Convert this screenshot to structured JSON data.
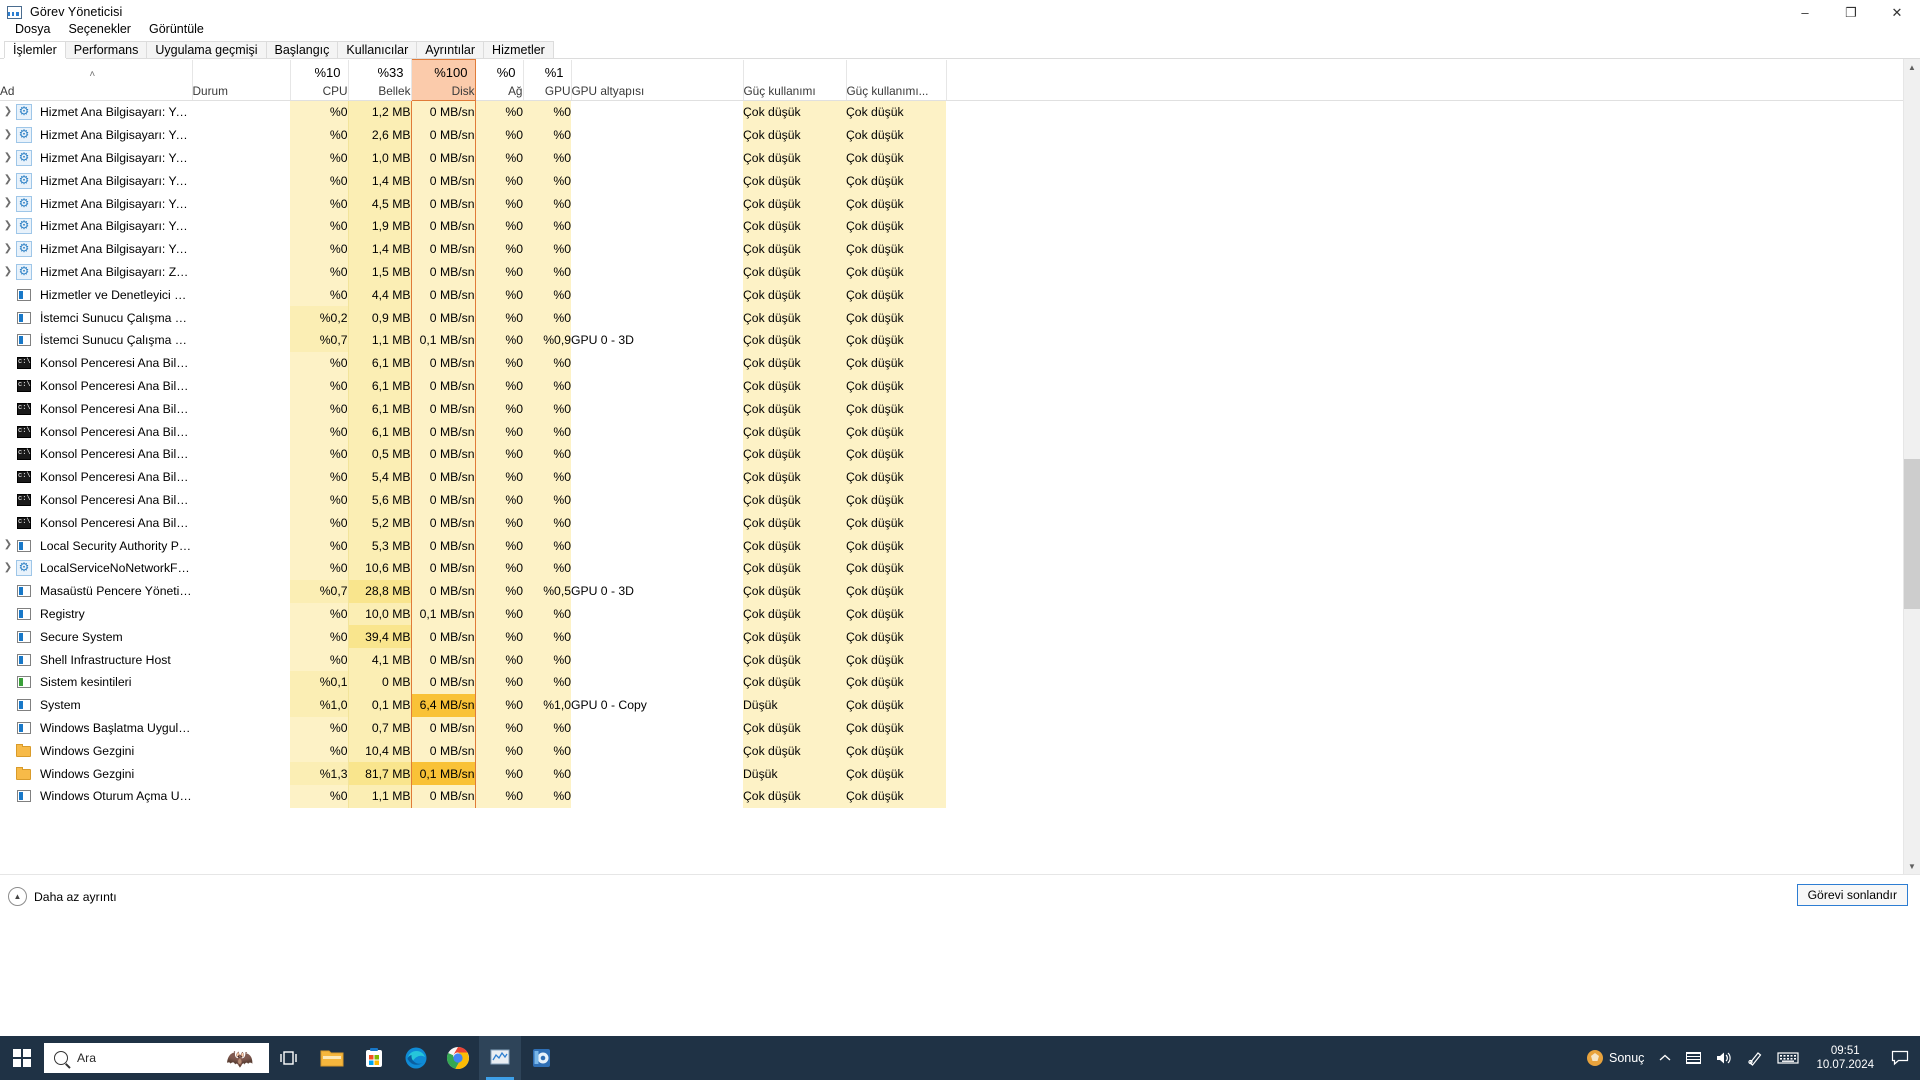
{
  "window": {
    "title": "Görev Yöneticisi",
    "icon": "task-manager-icon",
    "minimize": "–",
    "maximize": "❐",
    "close": "✕"
  },
  "menu": [
    "Dosya",
    "Seçenekler",
    "Görüntüle"
  ],
  "tabs": [
    {
      "label": "İşlemler",
      "active": true
    },
    {
      "label": "Performans",
      "active": false
    },
    {
      "label": "Uygulama geçmişi",
      "active": false
    },
    {
      "label": "Başlangıç",
      "active": false
    },
    {
      "label": "Kullanıcılar",
      "active": false
    },
    {
      "label": "Ayrıntılar",
      "active": false
    },
    {
      "label": "Hizmetler",
      "active": false
    }
  ],
  "table": {
    "sort_arrow": "˄",
    "headers": [
      {
        "key": "name",
        "label": "Ad",
        "pct": "",
        "align": "left",
        "hot": false
      },
      {
        "key": "status",
        "label": "Durum",
        "pct": "",
        "align": "left",
        "hot": false
      },
      {
        "key": "cpu",
        "label": "CPU",
        "pct": "%10",
        "align": "right",
        "hot": false
      },
      {
        "key": "mem",
        "label": "Bellek",
        "pct": "%33",
        "align": "right",
        "hot": false
      },
      {
        "key": "disk",
        "label": "Disk",
        "pct": "%100",
        "align": "right",
        "hot": true
      },
      {
        "key": "net",
        "label": "Ağ",
        "pct": "%0",
        "align": "right",
        "hot": false
      },
      {
        "key": "gpu",
        "label": "GPU",
        "pct": "%1",
        "align": "right",
        "hot": false
      },
      {
        "key": "gpueng",
        "label": "GPU altyapısı",
        "pct": "",
        "align": "left",
        "hot": false
      },
      {
        "key": "power",
        "label": "Güç kullanımı",
        "pct": "",
        "align": "left",
        "hot": false
      },
      {
        "key": "powtr",
        "label": "Güç kullanımı...",
        "pct": "",
        "align": "left",
        "hot": false
      }
    ],
    "rows": [
      {
        "icon": "gear-icon",
        "expand": true,
        "name": "Hizmet Ana Bilgisayarı: Yerel Hiz...",
        "status": "",
        "cpu": "%0",
        "mem": "1,2 MB",
        "disk": "0 MB/sn",
        "net": "%0",
        "gpu": "%0",
        "gpueng": "",
        "power": "Çok düşük",
        "powtr": "Çok düşük",
        "memLevel": 1,
        "diskLevel": 0,
        "cpuLevel": 0
      },
      {
        "icon": "gear-icon",
        "expand": true,
        "name": "Hizmet Ana Bilgisayarı: Yerel Hiz...",
        "status": "",
        "cpu": "%0",
        "mem": "2,6 MB",
        "disk": "0 MB/sn",
        "net": "%0",
        "gpu": "%0",
        "gpueng": "",
        "power": "Çok düşük",
        "powtr": "Çok düşük",
        "memLevel": 1,
        "diskLevel": 0,
        "cpuLevel": 0
      },
      {
        "icon": "gear-icon",
        "expand": true,
        "name": "Hizmet Ana Bilgisayarı: Yerel Hiz...",
        "status": "",
        "cpu": "%0",
        "mem": "1,0 MB",
        "disk": "0 MB/sn",
        "net": "%0",
        "gpu": "%0",
        "gpueng": "",
        "power": "Çok düşük",
        "powtr": "Çok düşük",
        "memLevel": 1,
        "diskLevel": 0,
        "cpuLevel": 0
      },
      {
        "icon": "gear-icon",
        "expand": true,
        "name": "Hizmet Ana Bilgisayarı: Yerel Ot...",
        "status": "",
        "cpu": "%0",
        "mem": "1,4 MB",
        "disk": "0 MB/sn",
        "net": "%0",
        "gpu": "%0",
        "gpueng": "",
        "power": "Çok düşük",
        "powtr": "Çok düşük",
        "memLevel": 1,
        "diskLevel": 0,
        "cpuLevel": 0
      },
      {
        "icon": "gear-icon",
        "expand": true,
        "name": "Hizmet Ana Bilgisayarı: Yerel Sis...",
        "status": "",
        "cpu": "%0",
        "mem": "4,5 MB",
        "disk": "0 MB/sn",
        "net": "%0",
        "gpu": "%0",
        "gpueng": "",
        "power": "Çok düşük",
        "powtr": "Çok düşük",
        "memLevel": 1,
        "diskLevel": 0,
        "cpuLevel": 0
      },
      {
        "icon": "gear-icon",
        "expand": true,
        "name": "Hizmet Ana Bilgisayarı: Yerel Sis...",
        "status": "",
        "cpu": "%0",
        "mem": "1,9 MB",
        "disk": "0 MB/sn",
        "net": "%0",
        "gpu": "%0",
        "gpueng": "",
        "power": "Çok düşük",
        "powtr": "Çok düşük",
        "memLevel": 1,
        "diskLevel": 0,
        "cpuLevel": 0
      },
      {
        "icon": "gear-icon",
        "expand": true,
        "name": "Hizmet Ana Bilgisayarı: Yetenek ...",
        "status": "",
        "cpu": "%0",
        "mem": "1,4 MB",
        "disk": "0 MB/sn",
        "net": "%0",
        "gpu": "%0",
        "gpueng": "",
        "power": "Çok düşük",
        "powtr": "Çok düşük",
        "memLevel": 1,
        "diskLevel": 0,
        "cpuLevel": 0
      },
      {
        "icon": "gear-icon",
        "expand": true,
        "name": "Hizmet Ana Bilgisayarı: Zaman ...",
        "status": "",
        "cpu": "%0",
        "mem": "1,5 MB",
        "disk": "0 MB/sn",
        "net": "%0",
        "gpu": "%0",
        "gpueng": "",
        "power": "Çok düşük",
        "powtr": "Çok düşük",
        "memLevel": 1,
        "diskLevel": 0,
        "cpuLevel": 0
      },
      {
        "icon": "app-icon",
        "expand": false,
        "name": "Hizmetler ve Denetleyici uygula...",
        "status": "",
        "cpu": "%0",
        "mem": "4,4 MB",
        "disk": "0 MB/sn",
        "net": "%0",
        "gpu": "%0",
        "gpueng": "",
        "power": "Çok düşük",
        "powtr": "Çok düşük",
        "memLevel": 1,
        "diskLevel": 0,
        "cpuLevel": 0
      },
      {
        "icon": "app-icon",
        "expand": false,
        "name": "İstemci Sunucu Çalışma Zamanı...",
        "status": "",
        "cpu": "%0,2",
        "mem": "0,9 MB",
        "disk": "0 MB/sn",
        "net": "%0",
        "gpu": "%0",
        "gpueng": "",
        "power": "Çok düşük",
        "powtr": "Çok düşük",
        "memLevel": 1,
        "diskLevel": 0,
        "cpuLevel": 1
      },
      {
        "icon": "app-icon",
        "expand": false,
        "name": "İstemci Sunucu Çalışma Zamanı...",
        "status": "",
        "cpu": "%0,7",
        "mem": "1,1 MB",
        "disk": "0,1 MB/sn",
        "net": "%0",
        "gpu": "%0,9",
        "gpueng": "GPU 0 - 3D",
        "power": "Çok düşük",
        "powtr": "Çok düşük",
        "memLevel": 1,
        "diskLevel": 0,
        "cpuLevel": 1
      },
      {
        "icon": "console-icon",
        "expand": false,
        "name": "Konsol Penceresi Ana Bilgisayarı",
        "status": "",
        "cpu": "%0",
        "mem": "6,1 MB",
        "disk": "0 MB/sn",
        "net": "%0",
        "gpu": "%0",
        "gpueng": "",
        "power": "Çok düşük",
        "powtr": "Çok düşük",
        "memLevel": 1,
        "diskLevel": 0,
        "cpuLevel": 0
      },
      {
        "icon": "console-icon",
        "expand": false,
        "name": "Konsol Penceresi Ana Bilgisayarı",
        "status": "",
        "cpu": "%0",
        "mem": "6,1 MB",
        "disk": "0 MB/sn",
        "net": "%0",
        "gpu": "%0",
        "gpueng": "",
        "power": "Çok düşük",
        "powtr": "Çok düşük",
        "memLevel": 1,
        "diskLevel": 0,
        "cpuLevel": 0
      },
      {
        "icon": "console-icon",
        "expand": false,
        "name": "Konsol Penceresi Ana Bilgisayarı",
        "status": "",
        "cpu": "%0",
        "mem": "6,1 MB",
        "disk": "0 MB/sn",
        "net": "%0",
        "gpu": "%0",
        "gpueng": "",
        "power": "Çok düşük",
        "powtr": "Çok düşük",
        "memLevel": 1,
        "diskLevel": 0,
        "cpuLevel": 0
      },
      {
        "icon": "console-icon",
        "expand": false,
        "name": "Konsol Penceresi Ana Bilgisayarı",
        "status": "",
        "cpu": "%0",
        "mem": "6,1 MB",
        "disk": "0 MB/sn",
        "net": "%0",
        "gpu": "%0",
        "gpueng": "",
        "power": "Çok düşük",
        "powtr": "Çok düşük",
        "memLevel": 1,
        "diskLevel": 0,
        "cpuLevel": 0
      },
      {
        "icon": "console-icon",
        "expand": false,
        "name": "Konsol Penceresi Ana Bilgisayarı",
        "status": "",
        "cpu": "%0",
        "mem": "0,5 MB",
        "disk": "0 MB/sn",
        "net": "%0",
        "gpu": "%0",
        "gpueng": "",
        "power": "Çok düşük",
        "powtr": "Çok düşük",
        "memLevel": 1,
        "diskLevel": 0,
        "cpuLevel": 0
      },
      {
        "icon": "console-icon",
        "expand": false,
        "name": "Konsol Penceresi Ana Bilgisayarı",
        "status": "",
        "cpu": "%0",
        "mem": "5,4 MB",
        "disk": "0 MB/sn",
        "net": "%0",
        "gpu": "%0",
        "gpueng": "",
        "power": "Çok düşük",
        "powtr": "Çok düşük",
        "memLevel": 1,
        "diskLevel": 0,
        "cpuLevel": 0
      },
      {
        "icon": "console-icon",
        "expand": false,
        "name": "Konsol Penceresi Ana Bilgisayarı",
        "status": "",
        "cpu": "%0",
        "mem": "5,6 MB",
        "disk": "0 MB/sn",
        "net": "%0",
        "gpu": "%0",
        "gpueng": "",
        "power": "Çok düşük",
        "powtr": "Çok düşük",
        "memLevel": 1,
        "diskLevel": 0,
        "cpuLevel": 0
      },
      {
        "icon": "console-icon",
        "expand": false,
        "name": "Konsol Penceresi Ana Bilgisayarı",
        "status": "",
        "cpu": "%0",
        "mem": "5,2 MB",
        "disk": "0 MB/sn",
        "net": "%0",
        "gpu": "%0",
        "gpueng": "",
        "power": "Çok düşük",
        "powtr": "Çok düşük",
        "memLevel": 1,
        "diskLevel": 0,
        "cpuLevel": 0
      },
      {
        "icon": "app-icon",
        "expand": true,
        "name": "Local Security Authority Process...",
        "status": "",
        "cpu": "%0",
        "mem": "5,3 MB",
        "disk": "0 MB/sn",
        "net": "%0",
        "gpu": "%0",
        "gpueng": "",
        "power": "Çok düşük",
        "powtr": "Çok düşük",
        "memLevel": 1,
        "diskLevel": 0,
        "cpuLevel": 0
      },
      {
        "icon": "gear-icon",
        "expand": true,
        "name": "LocalServiceNoNetworkFirewall ...",
        "status": "",
        "cpu": "%0",
        "mem": "10,6 MB",
        "disk": "0 MB/sn",
        "net": "%0",
        "gpu": "%0",
        "gpueng": "",
        "power": "Çok düşük",
        "powtr": "Çok düşük",
        "memLevel": 1,
        "diskLevel": 0,
        "cpuLevel": 0
      },
      {
        "icon": "app-icon",
        "expand": false,
        "name": "Masaüstü Pencere Yöneticisi",
        "status": "",
        "cpu": "%0,7",
        "mem": "28,8 MB",
        "disk": "0 MB/sn",
        "net": "%0",
        "gpu": "%0,5",
        "gpueng": "GPU 0 - 3D",
        "power": "Çok düşük",
        "powtr": "Çok düşük",
        "memLevel": 2,
        "diskLevel": 0,
        "cpuLevel": 1
      },
      {
        "icon": "app-icon",
        "expand": false,
        "name": "Registry",
        "status": "",
        "cpu": "%0",
        "mem": "10,0 MB",
        "disk": "0,1 MB/sn",
        "net": "%0",
        "gpu": "%0",
        "gpueng": "",
        "power": "Çok düşük",
        "powtr": "Çok düşük",
        "memLevel": 1,
        "diskLevel": 0,
        "cpuLevel": 0
      },
      {
        "icon": "app-icon",
        "expand": false,
        "name": "Secure System",
        "status": "",
        "cpu": "%0",
        "mem": "39,4 MB",
        "disk": "0 MB/sn",
        "net": "%0",
        "gpu": "%0",
        "gpueng": "",
        "power": "Çok düşük",
        "powtr": "Çok düşük",
        "memLevel": 2,
        "diskLevel": 0,
        "cpuLevel": 0
      },
      {
        "icon": "app-icon",
        "expand": false,
        "name": "Shell Infrastructure Host",
        "status": "",
        "cpu": "%0",
        "mem": "4,1 MB",
        "disk": "0 MB/sn",
        "net": "%0",
        "gpu": "%0",
        "gpueng": "",
        "power": "Çok düşük",
        "powtr": "Çok düşük",
        "memLevel": 1,
        "diskLevel": 0,
        "cpuLevel": 0
      },
      {
        "icon": "sysint-icon",
        "expand": false,
        "name": "Sistem kesintileri",
        "status": "",
        "cpu": "%0,1",
        "mem": "0 MB",
        "disk": "0 MB/sn",
        "net": "%0",
        "gpu": "%0",
        "gpueng": "",
        "power": "Çok düşük",
        "powtr": "Çok düşük",
        "memLevel": 1,
        "diskLevel": 0,
        "cpuLevel": 1
      },
      {
        "icon": "app-icon",
        "expand": false,
        "name": "System",
        "status": "",
        "cpu": "%1,0",
        "mem": "0,1 MB",
        "disk": "6,4 MB/sn",
        "net": "%0",
        "gpu": "%1,0",
        "gpueng": "GPU 0 - Copy",
        "power": "Düşük",
        "powtr": "Çok düşük",
        "memLevel": 1,
        "diskLevel": 3,
        "cpuLevel": 1
      },
      {
        "icon": "app-icon",
        "expand": false,
        "name": "Windows Başlatma Uygulaması",
        "status": "",
        "cpu": "%0",
        "mem": "0,7 MB",
        "disk": "0 MB/sn",
        "net": "%0",
        "gpu": "%0",
        "gpueng": "",
        "power": "Çok düşük",
        "powtr": "Çok düşük",
        "memLevel": 1,
        "diskLevel": 0,
        "cpuLevel": 0
      },
      {
        "icon": "folder-icon",
        "expand": false,
        "name": "Windows Gezgini",
        "status": "",
        "cpu": "%0",
        "mem": "10,4 MB",
        "disk": "0 MB/sn",
        "net": "%0",
        "gpu": "%0",
        "gpueng": "",
        "power": "Çok düşük",
        "powtr": "Çok düşük",
        "memLevel": 1,
        "diskLevel": 0,
        "cpuLevel": 0
      },
      {
        "icon": "folder-icon",
        "expand": false,
        "name": "Windows Gezgini",
        "status": "",
        "cpu": "%1,3",
        "mem": "81,7 MB",
        "disk": "0,1 MB/sn",
        "net": "%0",
        "gpu": "%0",
        "gpueng": "",
        "power": "Düşük",
        "powtr": "Çok düşük",
        "memLevel": 2,
        "diskLevel": 3,
        "cpuLevel": 1
      },
      {
        "icon": "app-icon",
        "expand": false,
        "name": "Windows Oturum Açma Uygula...",
        "status": "",
        "cpu": "%0",
        "mem": "1,1 MB",
        "disk": "0 MB/sn",
        "net": "%0",
        "gpu": "%0",
        "gpueng": "",
        "power": "Çok düşük",
        "powtr": "Çok düşük",
        "memLevel": 1,
        "diskLevel": 0,
        "cpuLevel": 0
      }
    ]
  },
  "footer": {
    "less_detail": "Daha az ayrıntı",
    "less_detail_icon": "chevron-up-circle-icon",
    "end_task": "Görevi sonlandır"
  },
  "taskbar": {
    "start_icon": "windows-start-icon",
    "search_placeholder": "Ara",
    "search_icon": "search-icon",
    "search_decoration": "toucan-bird-icon",
    "pinned": [
      {
        "name": "task-view-icon",
        "glyph": "⌸"
      },
      {
        "name": "file-explorer-icon",
        "glyph": "Ὄ1"
      },
      {
        "name": "microsoft-store-icon",
        "glyph": ""
      },
      {
        "name": "microsoft-edge-icon",
        "glyph": ""
      },
      {
        "name": "google-chrome-icon",
        "glyph": ""
      },
      {
        "name": "task-manager-taskbar-icon",
        "glyph": ""
      },
      {
        "name": "settings-app-icon",
        "glyph": ""
      }
    ],
    "tray": {
      "app_label": "Sonuç",
      "app_icon": "sonuc-app-icon",
      "show_hidden_icon": "chevron-up-icon",
      "keyboard_layout_icon": "keyboard-layout-icon",
      "volume_icon": "speaker-icon",
      "pen_icon": "pen-icon",
      "touch_keyboard_icon": "touch-keyboard-icon",
      "time": "09:51",
      "date": "10.07.2024",
      "action_center_icon": "notification-icon"
    }
  },
  "colors": {
    "accent_hot": "#fbcbab",
    "accent_hot_border": "#e07b39",
    "cell_tint_1": "#fdf2c6",
    "cell_tint_2": "#fbeeb4",
    "cell_tint_3": "#f9e58d",
    "cell_tint_4": "#f9c237",
    "taskbar_bg": "#1f3245",
    "tab_active_bg": "#ffffff"
  }
}
